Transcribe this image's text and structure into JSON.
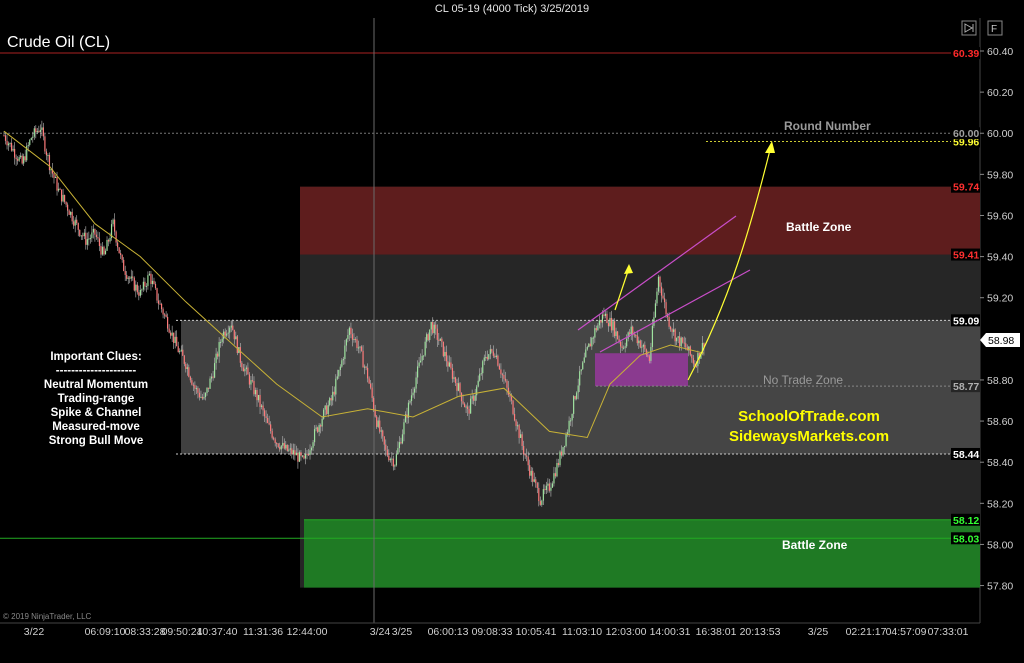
{
  "window": {
    "title": "CL 05-19 (4000 Tick)  3/25/2019"
  },
  "chart_data": {
    "type": "candlestick",
    "title": "Crude Oil (CL)",
    "copyright": "© 2019 NinjaTrader, LLC",
    "ylim": [
      57.7,
      60.48
    ],
    "y_ticks": [
      "60.40",
      "60.20",
      "60.00",
      "59.80",
      "59.60",
      "59.40",
      "59.20",
      "58.80",
      "58.60",
      "58.40",
      "58.20",
      "58.00",
      "57.80"
    ],
    "x_ticks": [
      "3/22",
      "06:09:10",
      "08:33:28",
      "09:50:24",
      "10:37:40",
      "11:31:36",
      "12:44:00",
      "3/24",
      "3/25",
      "06:00:13",
      "09:08:33",
      "10:05:41",
      "11:03:10",
      "12:03:00",
      "14:00:31",
      "16:38:01",
      "20:13:53",
      "3/25",
      "02:21:17",
      "04:57:09",
      "07:33:01"
    ],
    "current_price": "58.98",
    "price_labels": [
      {
        "value": 60.39,
        "text": "60.39",
        "color": "#ff2a2a"
      },
      {
        "value": 59.96,
        "text": "59.96",
        "color": "#ffff33"
      },
      {
        "value": 60.0,
        "text": "60.00",
        "color": "#a0a0a0"
      },
      {
        "value": 59.74,
        "text": "59.74",
        "color": "#ff3030"
      },
      {
        "value": 59.41,
        "text": "59.41",
        "color": "#ff3030"
      },
      {
        "value": 59.09,
        "text": "59.09",
        "color": "#ffffff"
      },
      {
        "value": 58.77,
        "text": "58.77",
        "color": "#b0b0b0"
      },
      {
        "value": 58.44,
        "text": "58.44",
        "color": "#ffffff"
      },
      {
        "value": 58.12,
        "text": "58.12",
        "color": "#33ff33"
      },
      {
        "value": 58.03,
        "text": "58.03",
        "color": "#33ff33"
      }
    ],
    "zones": [
      {
        "label": "Battle Zone",
        "from": 59.41,
        "to": 59.74,
        "color": "#5e1d1d"
      },
      {
        "label": "No Trade Zone",
        "from": 58.44,
        "to": 59.09,
        "color": "#4b4b4b"
      },
      {
        "label": "Battle Zone",
        "from": 57.79,
        "to": 58.12,
        "color": "#1f7a24"
      }
    ],
    "annotations": {
      "round_number": "Round Number",
      "clues_title": "Important Clues:",
      "clues_divider": "---------------------",
      "clues": [
        "Neutral Momentum",
        "Trading-range",
        "Spike & Channel",
        "Measured-move",
        "Strong Bull Move"
      ],
      "site1": "SchoolOfTrade.com",
      "site2": "SidewaysMarkets.com"
    },
    "price_path": [
      [
        0,
        59.99
      ],
      [
        6,
        59.92
      ],
      [
        12,
        59.85
      ],
      [
        18,
        59.98
      ],
      [
        24,
        60.03
      ],
      [
        30,
        59.85
      ],
      [
        36,
        59.72
      ],
      [
        42,
        59.64
      ],
      [
        48,
        59.55
      ],
      [
        54,
        59.48
      ],
      [
        60,
        59.51
      ],
      [
        66,
        59.4
      ],
      [
        72,
        59.56
      ],
      [
        78,
        59.36
      ],
      [
        84,
        59.28
      ],
      [
        90,
        59.22
      ],
      [
        96,
        59.31
      ],
      [
        102,
        59.18
      ],
      [
        108,
        59.08
      ],
      [
        114,
        58.96
      ],
      [
        120,
        58.88
      ],
      [
        126,
        58.76
      ],
      [
        132,
        58.7
      ],
      [
        138,
        58.84
      ],
      [
        144,
        59.02
      ],
      [
        150,
        59.08
      ],
      [
        156,
        58.9
      ],
      [
        162,
        58.8
      ],
      [
        168,
        58.7
      ],
      [
        174,
        58.58
      ],
      [
        180,
        58.5
      ],
      [
        186,
        58.46
      ],
      [
        192,
        58.44
      ],
      [
        198,
        58.4
      ],
      [
        204,
        58.52
      ],
      [
        210,
        58.62
      ],
      [
        216,
        58.7
      ],
      [
        222,
        58.86
      ],
      [
        228,
        59.05
      ],
      [
        234,
        58.96
      ],
      [
        240,
        58.82
      ],
      [
        246,
        58.6
      ],
      [
        252,
        58.45
      ],
      [
        258,
        58.4
      ],
      [
        264,
        58.58
      ],
      [
        270,
        58.76
      ],
      [
        276,
        58.92
      ],
      [
        282,
        59.07
      ],
      [
        288,
        58.98
      ],
      [
        294,
        58.86
      ],
      [
        300,
        58.76
      ],
      [
        306,
        58.64
      ],
      [
        312,
        58.76
      ],
      [
        318,
        58.92
      ],
      [
        324,
        58.94
      ],
      [
        330,
        58.8
      ],
      [
        336,
        58.66
      ],
      [
        342,
        58.48
      ],
      [
        348,
        58.34
      ],
      [
        354,
        58.22
      ],
      [
        360,
        58.28
      ],
      [
        366,
        58.4
      ],
      [
        372,
        58.56
      ],
      [
        378,
        58.76
      ],
      [
        384,
        58.92
      ],
      [
        390,
        59.04
      ],
      [
        396,
        59.12
      ],
      [
        402,
        59.06
      ],
      [
        408,
        58.96
      ],
      [
        414,
        59.04
      ],
      [
        420,
        58.98
      ],
      [
        426,
        58.9
      ],
      [
        432,
        59.3
      ],
      [
        438,
        59.1
      ],
      [
        444,
        59.0
      ],
      [
        450,
        58.96
      ],
      [
        456,
        58.88
      ],
      [
        462,
        58.98
      ]
    ],
    "ma_path": [
      [
        0,
        60.01
      ],
      [
        30,
        59.84
      ],
      [
        60,
        59.56
      ],
      [
        90,
        59.4
      ],
      [
        120,
        59.18
      ],
      [
        150,
        58.98
      ],
      [
        180,
        58.78
      ],
      [
        210,
        58.62
      ],
      [
        240,
        58.66
      ],
      [
        270,
        58.62
      ],
      [
        300,
        58.72
      ],
      [
        330,
        58.76
      ],
      [
        360,
        58.55
      ],
      [
        385,
        58.52
      ],
      [
        400,
        58.78
      ],
      [
        420,
        58.92
      ],
      [
        440,
        58.97
      ],
      [
        462,
        58.93
      ]
    ]
  }
}
